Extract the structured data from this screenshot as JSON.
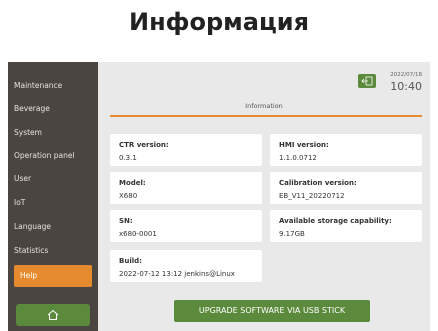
{
  "page_title": "Информация",
  "sidebar": {
    "items": [
      {
        "label": "Maintenance"
      },
      {
        "label": "Beverage"
      },
      {
        "label": "System"
      },
      {
        "label": "Operation panel"
      },
      {
        "label": "User"
      },
      {
        "label": "IoT"
      },
      {
        "label": "Language"
      },
      {
        "label": "Statistics"
      },
      {
        "label": "Help",
        "active": true
      }
    ],
    "home_icon": "home-icon"
  },
  "header": {
    "date": "2022/07/18",
    "time": "10:40",
    "back_icon": "back-icon"
  },
  "section_title": "Information",
  "info": {
    "ctr": {
      "label": "CTR version:",
      "value": "0.3.1"
    },
    "hmi": {
      "label": "HMI version:",
      "value": "1.1.0.0712"
    },
    "model": {
      "label": "Model:",
      "value": "X680"
    },
    "calibration": {
      "label": "Calibration version:",
      "value": "EB_V11_20220712"
    },
    "sn": {
      "label": "SN:",
      "value": "x680-0001"
    },
    "storage": {
      "label": "Available storage capability:",
      "value": "9.17GB"
    },
    "build": {
      "label": "Build:",
      "value": "2022-07-12 13:12 jenkins@Linux"
    }
  },
  "upgrade_button": "UPGRADE SOFTWARE VIA USB STICK",
  "colors": {
    "accent": "#e58b2e",
    "green": "#5b8a3c",
    "sidebar": "#4a4541"
  }
}
